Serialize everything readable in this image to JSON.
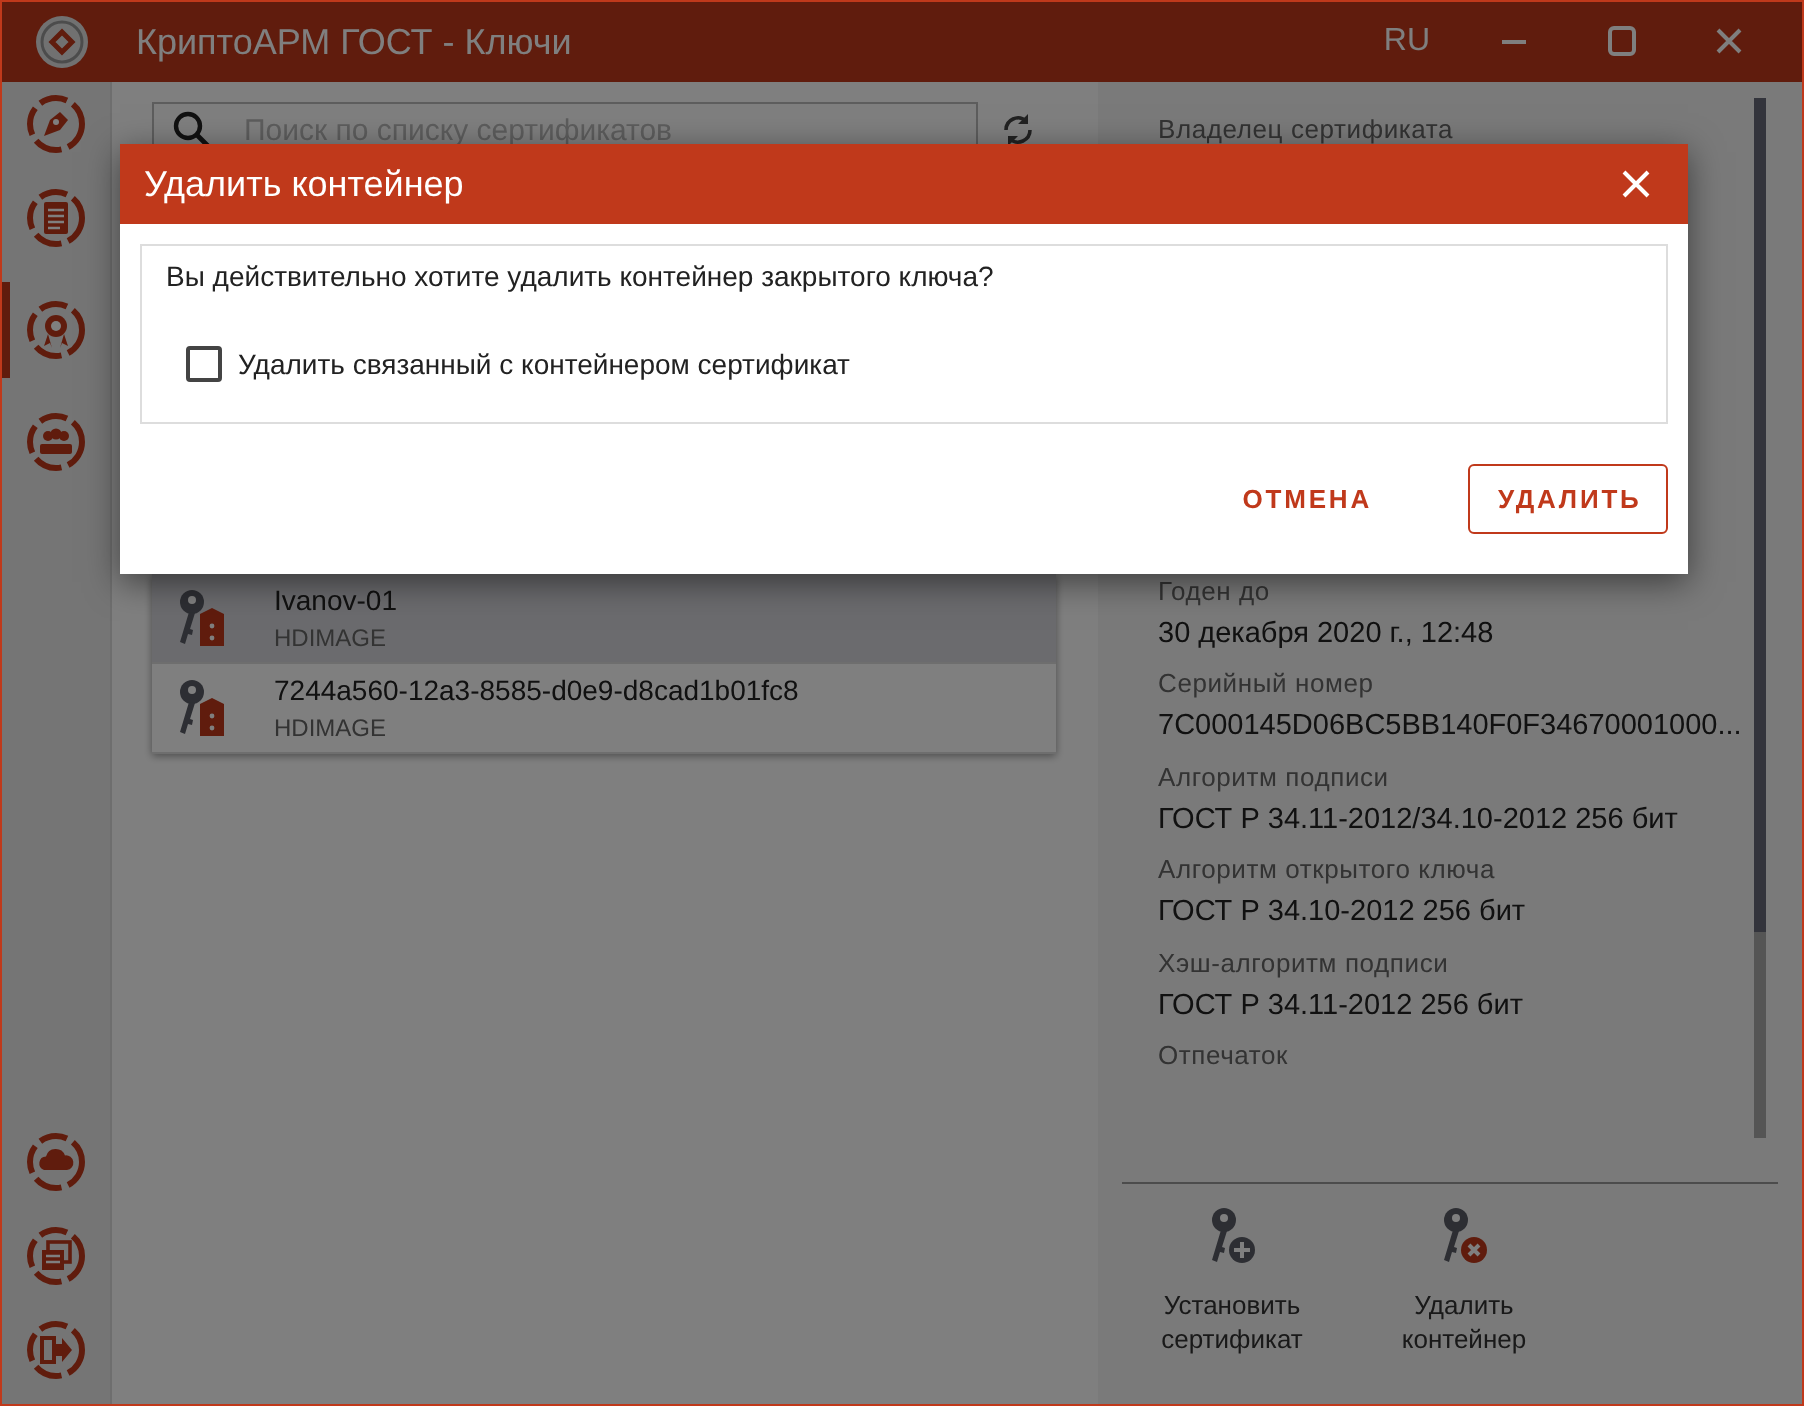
{
  "window": {
    "title": "КриптоАРМ ГОСТ - Ключи",
    "language": "RU"
  },
  "sidebar": {
    "top": [
      {
        "selected": false
      },
      {
        "selected": false
      },
      {
        "selected": true
      },
      {
        "selected": false
      }
    ],
    "bottom": [
      {
        "selected": false
      },
      {
        "selected": false
      },
      {
        "selected": false
      }
    ]
  },
  "search": {
    "placeholder": "Поиск по списку сертификатов"
  },
  "keys": [
    {
      "name": "Ivanov-01",
      "storage": "HDIMAGE",
      "selected": true
    },
    {
      "name": "7244a560-12a3-8585-d0e9-d8cad1b01fc8",
      "storage": "HDIMAGE",
      "selected": false
    }
  ],
  "details": [
    {
      "label": "Владелец сертификата"
    },
    {
      "label": "Годен до",
      "value": "30 декабря 2020 г., 12:48"
    },
    {
      "label": "Серийный номер",
      "value": "7C000145D06BC5BB140F0F34670001000..."
    },
    {
      "label": "Алгоритм подписи",
      "value": "ГОСТ Р 34.11-2012/34.10-2012 256 бит"
    },
    {
      "label": "Алгоритм открытого ключа",
      "value": "ГОСТ Р 34.10-2012 256 бит"
    },
    {
      "label": "Хэш-алгоритм подписи",
      "value": "ГОСТ Р 34.11-2012 256 бит"
    },
    {
      "label": "Отпечаток"
    }
  ],
  "actions": [
    {
      "kind": "install",
      "label": "Установить сертификат"
    },
    {
      "kind": "delete",
      "label": "Удалить контейнер"
    }
  ],
  "dialog": {
    "title": "Удалить контейнер",
    "message": "Вы действительно хотите удалить контейнер закрытого ключа?",
    "checkbox": {
      "label": "Удалить связанный с контейнером сертификат",
      "checked": false
    },
    "buttons": [
      {
        "kind": "text",
        "label": "ОТМЕНА"
      },
      {
        "kind": "outlined",
        "label": "УДАЛИТЬ"
      }
    ]
  }
}
